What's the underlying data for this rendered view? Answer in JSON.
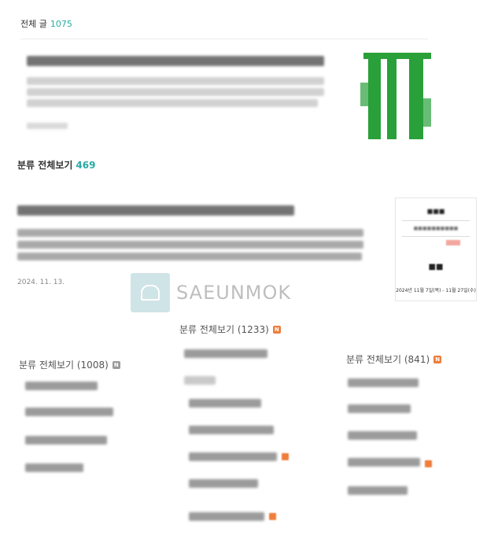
{
  "all_posts": {
    "label": "전체 글",
    "count": "1075"
  },
  "post1": {
    "thumbnail": "green-abstract-thumbnail"
  },
  "category_section": {
    "label": "분류 전체보기",
    "count": "469"
  },
  "post2": {
    "date": "2024. 11. 13.",
    "thumbnail_dates": "2024년 11월 7일(목) - 11월 27일(수)"
  },
  "watermark": {
    "text": "SAEUNMOK"
  },
  "categories": [
    {
      "label": "분류 전체보기 (1008)",
      "badge": "N",
      "badge_color": "#9a9a9a"
    },
    {
      "label": "분류 전체보기 (1233)",
      "badge": "N",
      "badge_color": "#ef7d3b"
    },
    {
      "label": "분류 전체보기 (841)",
      "badge": "N",
      "badge_color": "#ef7d3b"
    }
  ]
}
